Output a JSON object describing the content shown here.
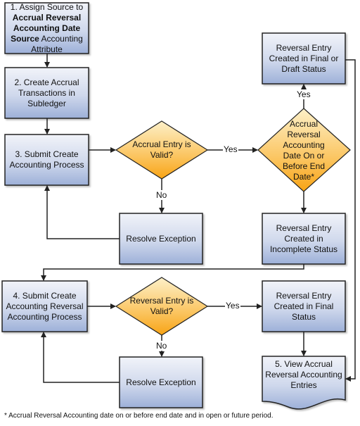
{
  "diagram": {
    "nodes": {
      "step1": {
        "parts": [
          {
            "text": "1. Assign Source to ",
            "bold": false
          },
          {
            "text": "Accrual Reversal Accounting Date Source",
            "bold": true
          },
          {
            "text": " Accounting Attribute",
            "bold": false
          }
        ]
      },
      "step2": "2. Create Accrual Transactions in Subledger",
      "step3": "3. Submit Create Accounting Process",
      "accrual_valid": "Accrual Entry is Valid?",
      "resolve1": "Resolve Exception",
      "date_check": "Accrual Reversal Accounting Date On or Before End Date*",
      "final_or_draft": "Reversal Entry Created in Final or Draft Status",
      "incomplete": "Reversal Entry Created in Incomplete Status",
      "step4": "4. Submit Create Accounting Reversal Accounting Process",
      "reversal_valid": "Reversal Entry is Valid?",
      "resolve2": "Resolve Exception",
      "final": "Reversal Entry Created in Final Status",
      "step5": "5. View Accrual Reversal Accounting Entries"
    },
    "labels": {
      "yes1": "Yes",
      "no1": "No",
      "yes2": "Yes",
      "yes3": "Yes",
      "no2": "No"
    },
    "footnote": "* Accrual Reversal Accounting date on or before end date and in open or future period.",
    "colors": {
      "process_top": "#eef1f8",
      "process_bottom": "#9fb1d8",
      "decision_top": "#fde9b8",
      "decision_bottom": "#f9a91d",
      "stroke": "#222222"
    }
  }
}
